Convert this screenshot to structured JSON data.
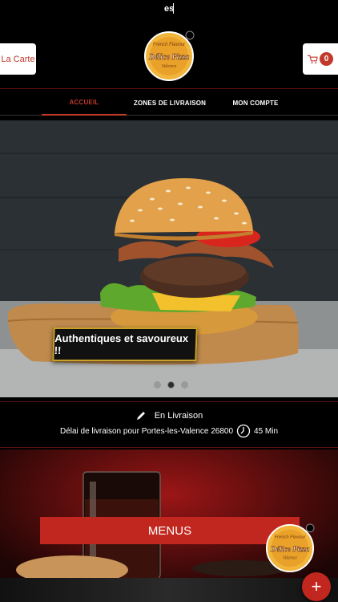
{
  "status_bar": {
    "language": "es"
  },
  "header": {
    "menu_button_label": "La Carte",
    "cart_count": "0",
    "logo": {
      "top_text": "French Flavour",
      "brand": "Délice Pizza",
      "city": "Valence"
    }
  },
  "nav": {
    "items": [
      {
        "label": "ACCUEIL",
        "active": true
      },
      {
        "label": "ZONES DE LIVRAISON",
        "active": false
      },
      {
        "label": "MON COMPTE",
        "active": false
      }
    ]
  },
  "hero": {
    "slide_label": "Authentiques et savoureux !!",
    "slide_count": 3,
    "active_slide_index": 1
  },
  "delivery": {
    "mode_label": "En Livraison",
    "delay_label": "Délai de livraison pour Portes-les-Valence 26800",
    "delay_value": "45 Min"
  },
  "menus": {
    "label": "MENUS"
  },
  "fab": {
    "label": "+"
  },
  "colors": {
    "accent": "#c1271e",
    "background": "#000000",
    "gold": "#c9a227"
  }
}
